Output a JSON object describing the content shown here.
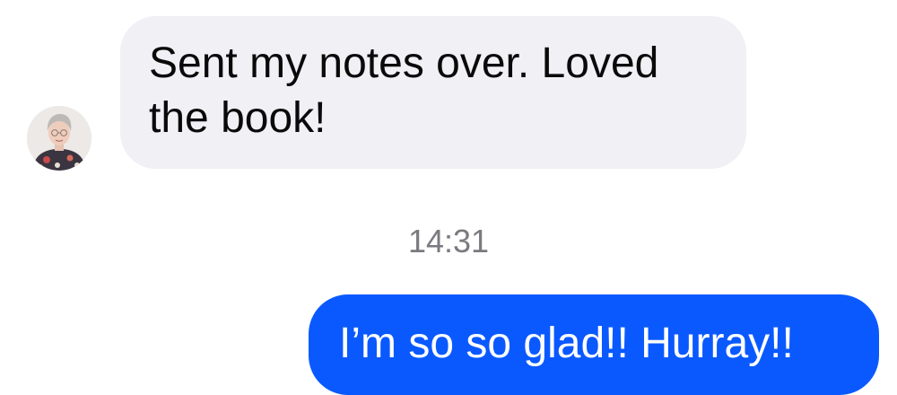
{
  "colors": {
    "incoming_bubble": "#f0f0f5",
    "outgoing_bubble": "#0a59ff",
    "timestamp_text": "#7a7a80"
  },
  "conversation": {
    "messages": [
      {
        "direction": "incoming",
        "text": "Sent my notes over. Loved\nthe book!",
        "sender_avatar": "avatar-photo"
      },
      {
        "direction": "outgoing",
        "text": "I’m so so glad!! Hurray!!"
      }
    ],
    "timestamp": "14:31"
  }
}
